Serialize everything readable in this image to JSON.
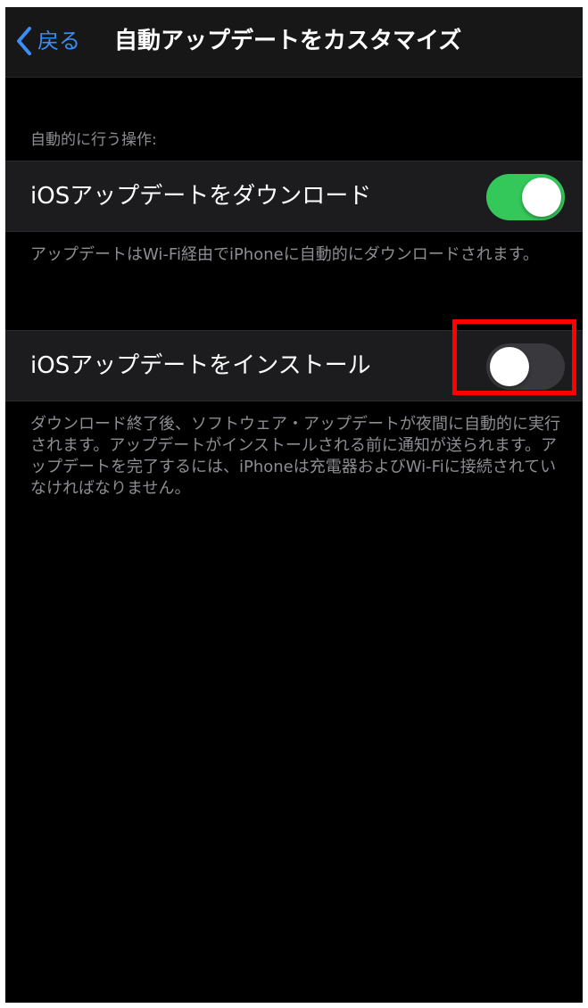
{
  "nav": {
    "back_label": "戻る",
    "title": "自動アップデートをカスタマイズ"
  },
  "section": {
    "header": "自動的に行う操作:"
  },
  "rows": [
    {
      "label": "iOSアップデートをダウンロード",
      "enabled": true,
      "footer": "アップデートはWi-Fi経由でiPhoneに自動的にダウンロードされます。"
    },
    {
      "label": "iOSアップデートをインストール",
      "enabled": false,
      "footer": "ダウンロード終了後、ソフトウェア・アップデートが夜間に自動的に実行されます。アップデートがインストールされる前に通知が送られます。アップデートを完了するには、iPhoneは充電器およびWi-Fiに接続されていなければなりません。"
    }
  ],
  "colors": {
    "accent": "#3a8ef6",
    "toggle_on": "#34c759",
    "toggle_off": "#39393d",
    "highlight": "#ff0000"
  },
  "icons": {
    "back": "chevron-left-icon"
  }
}
